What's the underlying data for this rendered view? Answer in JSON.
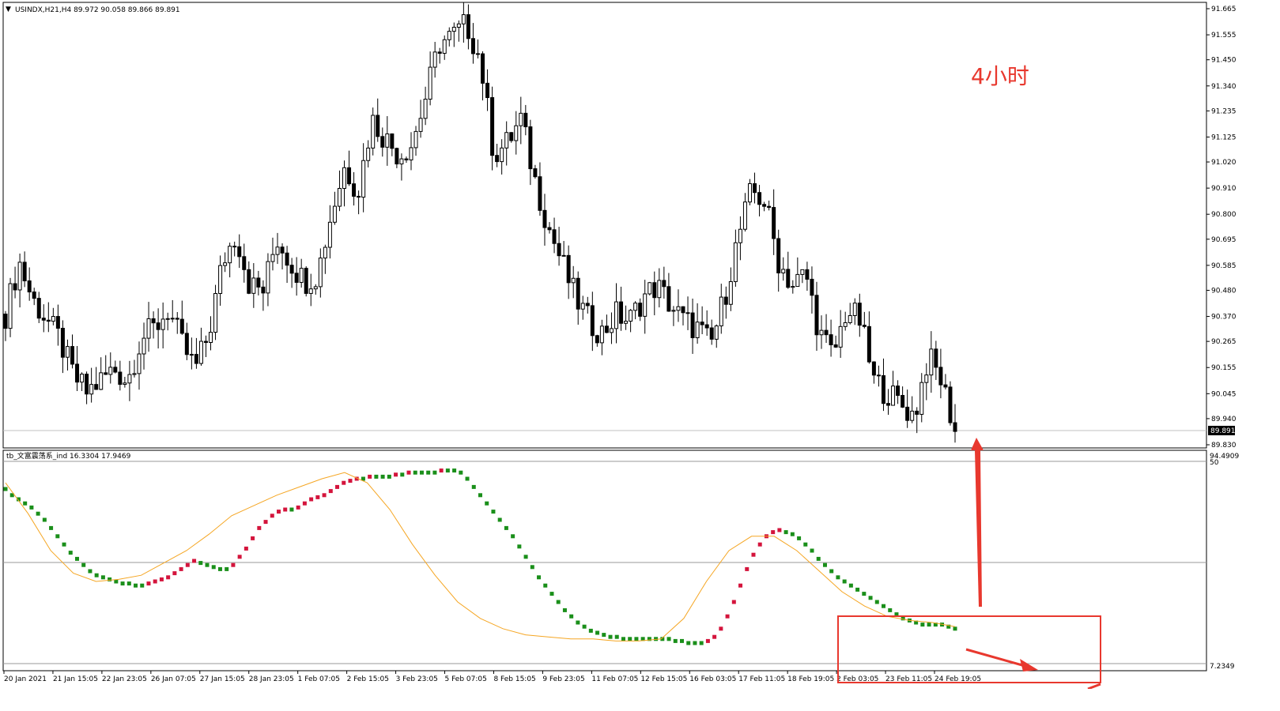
{
  "chart_data": {
    "type": "candlestick",
    "symbol_header": "USINDX,H21,H4  89.972 90.058 89.866 89.891",
    "annotation": "4小时",
    "price_axis": {
      "ticks": [
        "91.665",
        "91.555",
        "91.450",
        "91.340",
        "91.235",
        "91.125",
        "91.020",
        "90.910",
        "90.800",
        "90.695",
        "90.585",
        "90.480",
        "90.370",
        "90.265",
        "90.155",
        "90.045",
        "89.940",
        "89.830"
      ],
      "current_price": "89.891",
      "ylim": [
        89.83,
        91.665
      ]
    },
    "indicator": {
      "header": "tb_文富震荡系_ind 16.3304 17.9469",
      "axis_labels": [
        "94.4909",
        "50",
        "50",
        "50",
        "7.2349"
      ],
      "ylim": [
        7.2349,
        94.4909
      ]
    },
    "time_axis": [
      "20 Jan 2021",
      "21 Jan 15:05",
      "22 Jan 23:05",
      "26 Jan 07:05",
      "27 Jan 15:05",
      "28 Jan 23:05",
      "1 Feb 07:05",
      "2 Feb 15:05",
      "3 Feb 23:05",
      "5 Feb 07:05",
      "8 Feb 15:05",
      "9 Feb 23:05",
      "11 Feb 07:05",
      "12 Feb 15:05",
      "16 Feb 03:05",
      "17 Feb 11:05",
      "18 Feb 19:05",
      "2 Feb 03:05",
      "23 Feb 11:05",
      "24 Feb 19:05"
    ],
    "close_path": [
      90.38,
      90.6,
      90.44,
      90.36,
      90.27,
      90.12,
      90.05,
      90.1,
      90.15,
      90.1,
      90.28,
      90.32,
      90.4,
      90.25,
      90.15,
      90.3,
      90.6,
      90.72,
      90.5,
      90.48,
      90.7,
      90.6,
      90.52,
      90.55,
      90.8,
      91.0,
      90.9,
      91.2,
      91.12,
      91.05,
      91.1,
      91.3,
      91.52,
      91.55,
      91.6,
      91.45,
      91.05,
      91.1,
      91.2,
      90.95,
      90.75,
      90.6,
      90.45,
      90.35,
      90.3,
      90.38,
      90.35,
      90.45,
      90.5,
      90.42,
      90.35,
      90.32,
      90.25,
      90.45,
      90.7,
      90.9,
      90.85,
      90.6,
      90.5,
      90.55,
      90.3,
      90.2,
      90.4,
      90.35,
      90.1,
      90.05,
      90.0,
      89.95,
      90.2,
      90.1,
      89.89
    ],
    "osc_points": [
      [
        0,
        85
      ],
      [
        1,
        82
      ],
      [
        2,
        80
      ],
      [
        3,
        78
      ],
      [
        4,
        76
      ],
      [
        5,
        73
      ],
      [
        6,
        70
      ],
      [
        7,
        66
      ],
      [
        8,
        62
      ],
      [
        9,
        58
      ],
      [
        10,
        54
      ],
      [
        11,
        51
      ],
      [
        12,
        48
      ],
      [
        13,
        45
      ],
      [
        14,
        43
      ],
      [
        15,
        42
      ],
      [
        16,
        41
      ],
      [
        17,
        40
      ],
      [
        18,
        39
      ],
      [
        19,
        39
      ],
      [
        20,
        38
      ],
      [
        21,
        38
      ],
      [
        22,
        39
      ],
      [
        23,
        40
      ],
      [
        24,
        41
      ],
      [
        25,
        42
      ],
      [
        26,
        44
      ],
      [
        27,
        46
      ],
      [
        28,
        48
      ],
      [
        29,
        50
      ],
      [
        30,
        49
      ],
      [
        31,
        48
      ],
      [
        32,
        47
      ],
      [
        33,
        46
      ],
      [
        34,
        46
      ],
      [
        35,
        48
      ],
      [
        36,
        52
      ],
      [
        37,
        56
      ],
      [
        38,
        61
      ],
      [
        39,
        66
      ],
      [
        40,
        69
      ],
      [
        41,
        72
      ],
      [
        42,
        74
      ],
      [
        43,
        75
      ],
      [
        44,
        75
      ],
      [
        45,
        76
      ],
      [
        46,
        78
      ],
      [
        47,
        80
      ],
      [
        48,
        81
      ],
      [
        49,
        82
      ],
      [
        50,
        84
      ],
      [
        51,
        86
      ],
      [
        52,
        88
      ],
      [
        53,
        89
      ],
      [
        54,
        90
      ],
      [
        55,
        90
      ],
      [
        56,
        91
      ],
      [
        57,
        91
      ],
      [
        58,
        91
      ],
      [
        59,
        91
      ],
      [
        60,
        92
      ],
      [
        61,
        92
      ],
      [
        62,
        93
      ],
      [
        63,
        93
      ],
      [
        64,
        93
      ],
      [
        65,
        93
      ],
      [
        66,
        93
      ],
      [
        67,
        94
      ],
      [
        68,
        94
      ],
      [
        69,
        94
      ],
      [
        70,
        93
      ],
      [
        71,
        90
      ],
      [
        72,
        86
      ],
      [
        73,
        82
      ],
      [
        74,
        78
      ],
      [
        75,
        74
      ],
      [
        76,
        70
      ],
      [
        77,
        66
      ],
      [
        78,
        62
      ],
      [
        79,
        57
      ],
      [
        80,
        52
      ],
      [
        81,
        47
      ],
      [
        82,
        42
      ],
      [
        83,
        38
      ],
      [
        84,
        34
      ],
      [
        85,
        30
      ],
      [
        86,
        26
      ],
      [
        87,
        23
      ],
      [
        88,
        20
      ],
      [
        89,
        18
      ],
      [
        90,
        16
      ],
      [
        91,
        15
      ],
      [
        92,
        14
      ],
      [
        93,
        13
      ],
      [
        94,
        13
      ],
      [
        95,
        12
      ],
      [
        96,
        12
      ],
      [
        97,
        12
      ],
      [
        98,
        12
      ],
      [
        99,
        12
      ],
      [
        100,
        12
      ],
      [
        101,
        12
      ],
      [
        102,
        12
      ],
      [
        103,
        11
      ],
      [
        104,
        11
      ],
      [
        105,
        10
      ],
      [
        106,
        10
      ],
      [
        107,
        10
      ],
      [
        108,
        11
      ],
      [
        109,
        13
      ],
      [
        110,
        17
      ],
      [
        111,
        23
      ],
      [
        112,
        30
      ],
      [
        113,
        38
      ],
      [
        114,
        46
      ],
      [
        115,
        53
      ],
      [
        116,
        58
      ],
      [
        117,
        62
      ],
      [
        118,
        64
      ],
      [
        119,
        65
      ],
      [
        120,
        64
      ],
      [
        121,
        63
      ],
      [
        122,
        61
      ],
      [
        123,
        58
      ],
      [
        124,
        55
      ],
      [
        125,
        51
      ],
      [
        126,
        48
      ],
      [
        127,
        45
      ],
      [
        128,
        42
      ],
      [
        129,
        40
      ],
      [
        130,
        38
      ],
      [
        131,
        36
      ],
      [
        132,
        34
      ],
      [
        133,
        32
      ],
      [
        134,
        30
      ],
      [
        135,
        28
      ],
      [
        136,
        26
      ],
      [
        137,
        24
      ],
      [
        138,
        22
      ],
      [
        139,
        21
      ],
      [
        140,
        20
      ],
      [
        141,
        19
      ],
      [
        142,
        19
      ],
      [
        143,
        19
      ],
      [
        144,
        19
      ],
      [
        145,
        18
      ],
      [
        146,
        17
      ]
    ],
    "ma_points": [
      [
        0,
        88
      ],
      [
        10,
        73
      ],
      [
        20,
        55
      ],
      [
        30,
        44
      ],
      [
        40,
        40
      ],
      [
        50,
        41
      ],
      [
        60,
        43
      ],
      [
        70,
        49
      ],
      [
        80,
        55
      ],
      [
        90,
        63
      ],
      [
        100,
        72
      ],
      [
        110,
        77
      ],
      [
        120,
        82
      ],
      [
        130,
        86
      ],
      [
        140,
        90
      ],
      [
        150,
        93
      ],
      [
        160,
        88
      ],
      [
        170,
        75
      ],
      [
        180,
        58
      ],
      [
        190,
        43
      ],
      [
        200,
        30
      ],
      [
        210,
        22
      ],
      [
        220,
        17
      ],
      [
        230,
        14
      ],
      [
        240,
        13
      ],
      [
        250,
        12
      ],
      [
        260,
        12
      ],
      [
        270,
        11
      ],
      [
        280,
        11
      ],
      [
        290,
        12
      ],
      [
        300,
        22
      ],
      [
        310,
        40
      ],
      [
        320,
        55
      ],
      [
        330,
        62
      ],
      [
        340,
        62
      ],
      [
        350,
        55
      ],
      [
        360,
        45
      ],
      [
        370,
        35
      ],
      [
        380,
        28
      ],
      [
        390,
        23
      ],
      [
        400,
        21
      ],
      [
        410,
        20
      ],
      [
        420,
        18
      ]
    ],
    "colors": {
      "bull": "#1a8f1a",
      "bear": "#d4143c",
      "ma": "#f5a623",
      "annotation": "#e8382e"
    }
  }
}
